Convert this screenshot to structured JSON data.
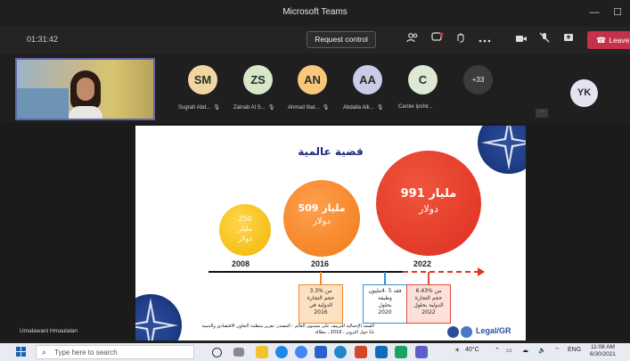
{
  "window": {
    "title": "Microsoft Teams",
    "minimize": "—",
    "maximize": "☐"
  },
  "toolbar": {
    "timer": "01:31:42",
    "request_control": "Request control",
    "leave": "Leave"
  },
  "participants": [
    {
      "initials": "SM",
      "name": "Sugrah Abd...",
      "color": "#f2d6a2"
    },
    {
      "initials": "ZS",
      "name": "Zainab Al S...",
      "color": "#d6e8c8"
    },
    {
      "initials": "AN",
      "name": "Ahmad Ibat...",
      "color": "#f7c77a"
    },
    {
      "initials": "AA",
      "name": "Abdalla Alk...",
      "color": "#c9cbe8"
    },
    {
      "initials": "C",
      "name": "Carole  Ipshir...",
      "color": "#dde9d5"
    },
    {
      "initials": "+33",
      "name": "",
      "color": "#3b3b3b"
    },
    {
      "initials": "YK",
      "name": "",
      "color": "#e6e2f2"
    }
  ],
  "slide": {
    "title": "قضية عالمية",
    "bubbles": [
      {
        "line1": "250",
        "line2": "مليار",
        "line3": "دولار",
        "year": "2008"
      },
      {
        "line1": "509 مليار",
        "line2": "دولار",
        "year": "2016"
      },
      {
        "line1": "991 مليار",
        "line2": "دولار",
        "year": "2022"
      }
    ],
    "boxes": [
      {
        "l1": "3.3% من",
        "l2": "حجم التجارة",
        "l3": "الدولية في",
        "l4": "2016"
      },
      {
        "l1": "فقد 5 .4مليون",
        "l2": "وظيفة",
        "l3": "بحلول",
        "l4": "2020"
      },
      {
        "l1": "6.43% من",
        "l2": "حجم التجارة",
        "l3": "الدولية بحلول",
        "l4": "2022"
      }
    ],
    "footer": "القيمة الإجمالية للتزييف على مستوى العالم - المصدر: تقرير منظمة التعاون الاقتصادي والتنمية حول التزوير ، 2016 ، مطالة LL",
    "logo": "Legal/GR"
  },
  "presenter": "Umalawani Hmaulalan",
  "taskbar": {
    "search_placeholder": "Type here to search",
    "temp": "40°C",
    "lang": "ENG",
    "time": "11:08 AM",
    "date": "6/30/2021"
  }
}
